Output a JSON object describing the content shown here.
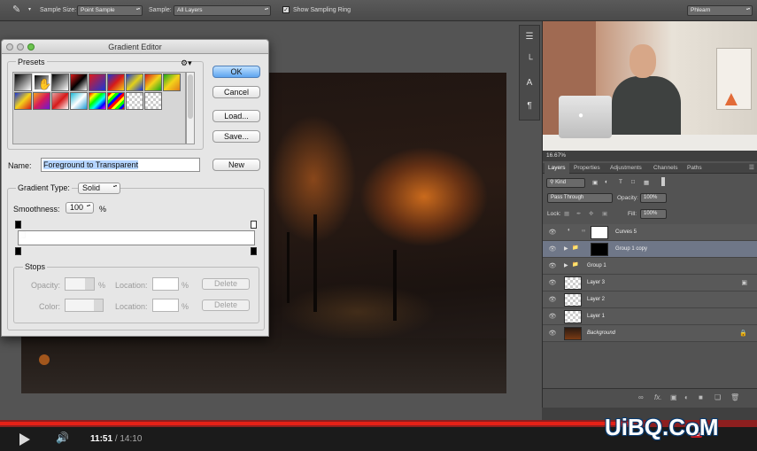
{
  "options_bar": {
    "sample_size_label": "Sample Size:",
    "sample_size_value": "Point Sample",
    "sample_label": "Sample:",
    "sample_value": "All Layers",
    "show_ring_label": "Show Sampling Ring",
    "workspace_value": "Phlearn"
  },
  "dialog": {
    "title": "Gradient Editor",
    "presets_label": "Presets",
    "ok_label": "OK",
    "cancel_label": "Cancel",
    "load_label": "Load...",
    "save_label": "Save...",
    "name_label": "Name:",
    "name_value": "Foreground to Transparent",
    "new_label": "New",
    "gradient_type_label": "Gradient Type:",
    "gradient_type_value": "Solid",
    "smoothness_label": "Smoothness:",
    "smoothness_value": "100",
    "smoothness_unit": "%",
    "stops_label": "Stops",
    "opacity_label": "Opacity:",
    "opacity_unit": "%",
    "color_label": "Color:",
    "location_label": "Location:",
    "location_unit": "%",
    "delete_label": "Delete"
  },
  "panel": {
    "zoom": "16.67%",
    "tabs": [
      "Layers",
      "Properties",
      "Adjustments",
      "Channels",
      "Paths"
    ],
    "kind_label": "Kind",
    "blend_mode": "Pass Through",
    "opacity_label": "Opacity:",
    "opacity_value": "100%",
    "lock_label": "Lock:",
    "fill_label": "Fill:",
    "fill_value": "100%",
    "layers": [
      {
        "name": "Curves 5",
        "selected": false
      },
      {
        "name": "Group 1 copy",
        "selected": true
      },
      {
        "name": "Group 1",
        "selected": false
      },
      {
        "name": "Layer 3",
        "selected": false
      },
      {
        "name": "Layer 2",
        "selected": false
      },
      {
        "name": "Layer 1",
        "selected": false
      },
      {
        "name": "Background",
        "selected": false
      }
    ]
  },
  "player": {
    "current_time": "11:51",
    "separator": "/",
    "total_time": "14:10",
    "progress": 0.836,
    "watermark": "UiBQ.CoM",
    "hd_badge": "HD"
  },
  "colors": {
    "youtube_red": "#e62117",
    "selection_blue": "#6f7788",
    "ok_button": "#5ea5ef"
  }
}
